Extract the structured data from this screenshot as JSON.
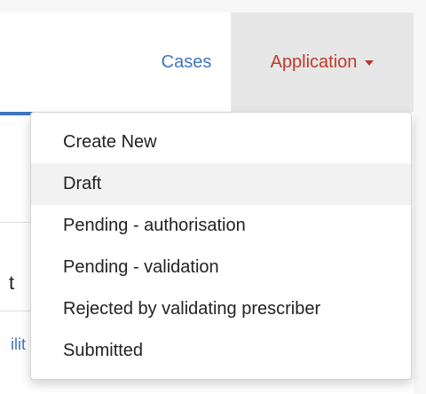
{
  "nav": {
    "cases_label": "Cases",
    "application_label": "Application",
    "accent_color": "#c0392b",
    "link_color": "#3f74c2"
  },
  "background": {
    "column_fragment": "t",
    "link_fragment": "ilit"
  },
  "dropdown": {
    "items": [
      {
        "label": "Create New"
      },
      {
        "label": "Draft"
      },
      {
        "label": "Pending - authorisation"
      },
      {
        "label": "Pending - validation"
      },
      {
        "label": "Rejected by validating prescriber"
      },
      {
        "label": "Submitted"
      }
    ],
    "highlighted_item": "Draft"
  }
}
